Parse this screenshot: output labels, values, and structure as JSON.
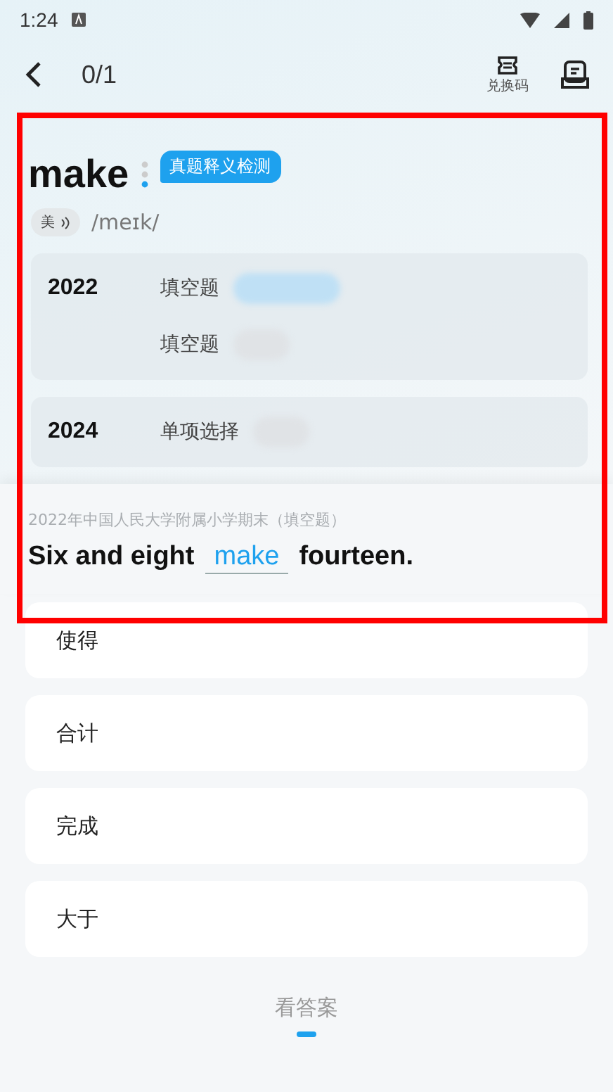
{
  "status_bar": {
    "time": "1:24"
  },
  "header": {
    "counter": "0/1",
    "redeem_label": "兑换码"
  },
  "word": {
    "text": "make",
    "badge": "真题释义检测",
    "accent": "美",
    "phonetic": "/meɪk/"
  },
  "exam_groups": [
    {
      "year": "2022",
      "entries": [
        {
          "type": "填空题",
          "highlighted": true
        },
        {
          "type": "填空题",
          "highlighted": false
        }
      ]
    },
    {
      "year": "2024",
      "entries": [
        {
          "type": "单项选择",
          "highlighted": false
        }
      ]
    }
  ],
  "question": {
    "source": "2022年中国人民大学附属小学期末（填空题）",
    "before": "Six and eight",
    "answer": "make",
    "after": "fourteen."
  },
  "options": [
    {
      "label": "使得"
    },
    {
      "label": "合计"
    },
    {
      "label": "完成"
    },
    {
      "label": "大于"
    }
  ],
  "show_answer": "看答案",
  "annotation_frame": true
}
